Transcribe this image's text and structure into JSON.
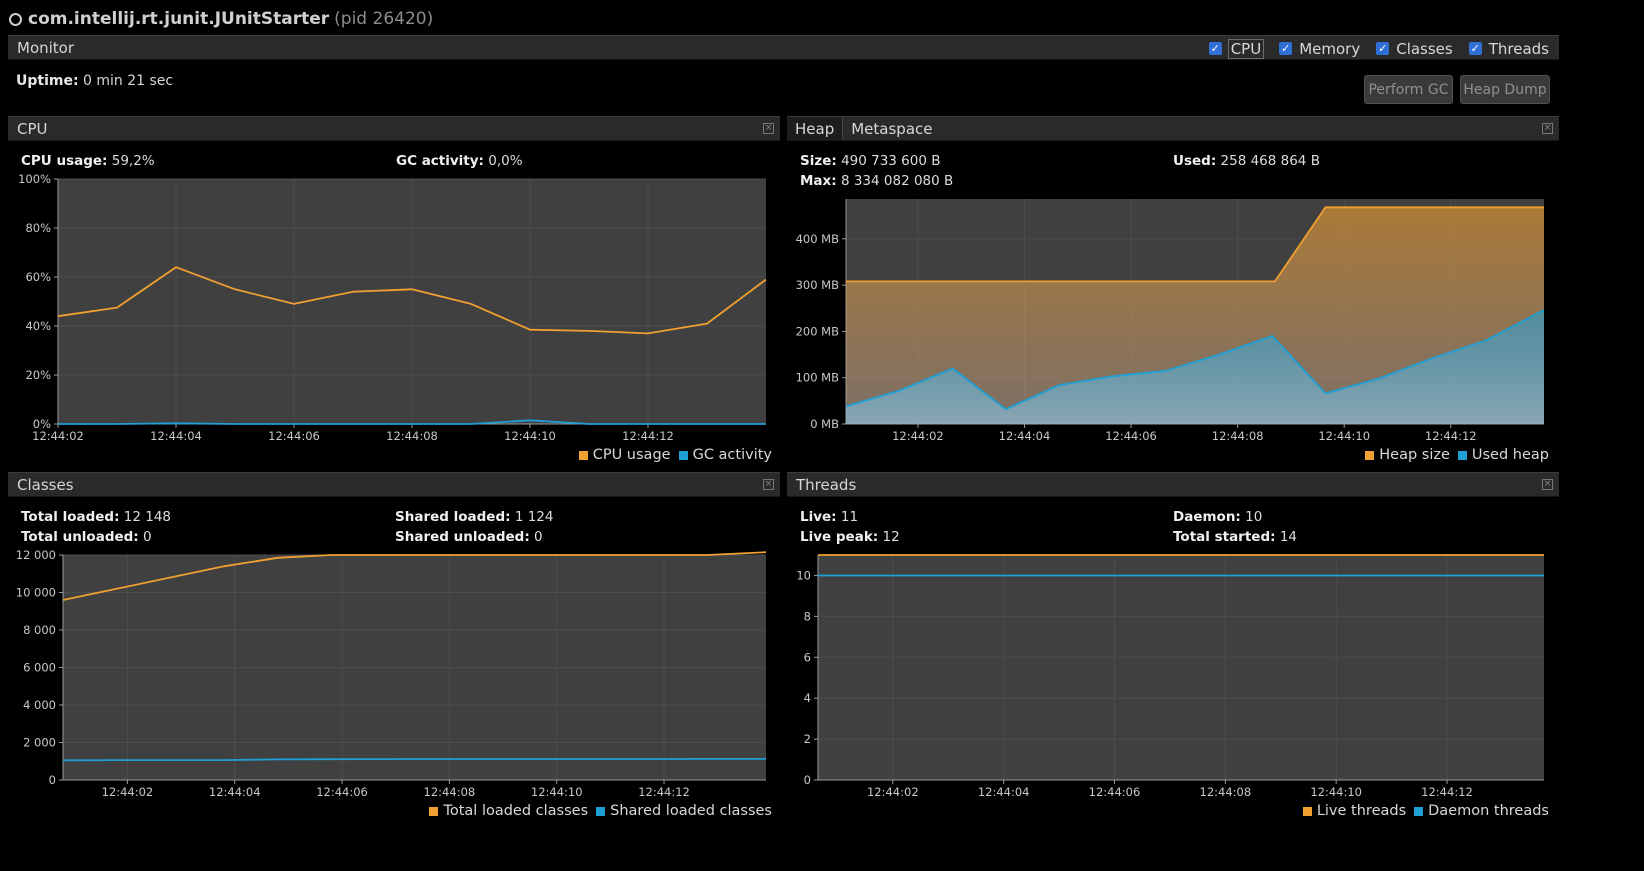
{
  "title": {
    "main": "com.intellij.rt.junit.JUnitStarter",
    "pid": "(pid 26420)"
  },
  "monitor": {
    "label": "Monitor",
    "checkboxes": [
      {
        "label": "CPU",
        "checked": true
      },
      {
        "label": "Memory",
        "checked": true
      },
      {
        "label": "Classes",
        "checked": true
      },
      {
        "label": "Threads",
        "checked": true
      }
    ],
    "uptime_label": "Uptime:",
    "uptime_value": "0 min 21 sec",
    "perform_gc": "Perform GC",
    "heap_dump": "Heap Dump"
  },
  "colors": {
    "orange": "#f0a030",
    "blue": "#1e9fd6",
    "plot_bg": "#404040"
  },
  "cpu": {
    "title": "CPU",
    "usage_label": "CPU usage:",
    "usage_value": "59,2%",
    "gc_label": "GC activity:",
    "gc_value": "0,0%",
    "legend": [
      "CPU usage",
      "GC activity"
    ]
  },
  "heap": {
    "tabs": [
      "Heap",
      "Metaspace"
    ],
    "size_label": "Size:",
    "size_value": "490 733 600 B",
    "used_label": "Used:",
    "used_value": "258 468 864 B",
    "max_label": "Max:",
    "max_value": "8 334 082 080 B",
    "legend": [
      "Heap size",
      "Used heap"
    ]
  },
  "classes": {
    "title": "Classes",
    "total_loaded_label": "Total loaded:",
    "total_loaded_value": "12 148",
    "shared_loaded_label": "Shared loaded:",
    "shared_loaded_value": "1 124",
    "total_unloaded_label": "Total unloaded:",
    "total_unloaded_value": "0",
    "shared_unloaded_label": "Shared unloaded:",
    "shared_unloaded_value": "0",
    "legend": [
      "Total loaded classes",
      "Shared loaded classes"
    ]
  },
  "threads": {
    "title": "Threads",
    "live_label": "Live:",
    "live_value": "11",
    "daemon_label": "Daemon:",
    "daemon_value": "10",
    "peak_label": "Live peak:",
    "peak_value": "12",
    "started_label": "Total started:",
    "started_value": "14",
    "legend": [
      "Live threads",
      "Daemon threads"
    ]
  },
  "chart_data": [
    {
      "type": "line",
      "ylim": [
        0,
        100
      ],
      "yticks": [
        "0%",
        "20%",
        "40%",
        "60%",
        "80%",
        "100%"
      ],
      "ytick_values": [
        0,
        20,
        40,
        60,
        80,
        100
      ],
      "xlim": [
        0,
        12
      ],
      "xticks": [
        "12:44:02",
        "12:44:04",
        "12:44:06",
        "12:44:08",
        "12:44:10",
        "12:44:12"
      ],
      "xtick_values": [
        0,
        2,
        4,
        6,
        8,
        10
      ],
      "series": [
        {
          "name": "CPU usage",
          "color": "#f0a030",
          "x": [
            0,
            1,
            2,
            3,
            4,
            5,
            6,
            7,
            8,
            9,
            10,
            11,
            12
          ],
          "values": [
            44,
            47.5,
            64,
            55,
            49,
            54,
            55,
            49,
            38.5,
            38,
            37,
            41,
            59
          ]
        },
        {
          "name": "GC activity",
          "color": "#1e9fd6",
          "x": [
            0,
            1,
            2,
            3,
            4,
            5,
            6,
            7,
            8,
            9,
            10,
            11,
            12
          ],
          "values": [
            0,
            0,
            0.3,
            0,
            0,
            0,
            0,
            0,
            1.5,
            0,
            0,
            0,
            0
          ]
        }
      ]
    },
    {
      "type": "area",
      "ylim": [
        0,
        486
      ],
      "yticks": [
        "0 MB",
        "100 MB",
        "200 MB",
        "300 MB",
        "400 MB"
      ],
      "ytick_values": [
        0,
        100,
        200,
        300,
        400
      ],
      "xlim": [
        0,
        13.1
      ],
      "xticks": [
        "12:44:02",
        "12:44:04",
        "12:44:06",
        "12:44:08",
        "12:44:10",
        "12:44:12"
      ],
      "xtick_values": [
        1.35,
        3.35,
        5.35,
        7.35,
        9.35,
        11.35
      ],
      "series": [
        {
          "name": "Heap size",
          "color": "#f0a030",
          "x": [
            0,
            8.05,
            9.0,
            13.1
          ],
          "values": [
            308,
            308,
            468,
            468
          ]
        },
        {
          "name": "Used heap",
          "color": "#1e9fd6",
          "x": [
            0,
            1,
            2,
            3,
            4,
            5,
            6,
            7,
            8,
            9,
            10,
            11,
            12,
            13.1
          ],
          "values": [
            38,
            72,
            120,
            32,
            84,
            103,
            115,
            150,
            190,
            66,
            98,
            142,
            180,
            246
          ]
        }
      ]
    },
    {
      "type": "line",
      "ylim": [
        0,
        12000
      ],
      "yticks": [
        "0",
        "2 000",
        "4 000",
        "6 000",
        "8 000",
        "10 000",
        "12 000"
      ],
      "ytick_values": [
        0,
        2000,
        4000,
        6000,
        8000,
        10000,
        12000
      ],
      "xlim": [
        0,
        13.1
      ],
      "xticks": [
        "12:44:02",
        "12:44:04",
        "12:44:06",
        "12:44:08",
        "12:44:10",
        "12:44:12"
      ],
      "xtick_values": [
        1.2,
        3.2,
        5.2,
        7.2,
        9.2,
        11.2
      ],
      "series": [
        {
          "name": "Total loaded classes",
          "color": "#f0a030",
          "x": [
            0,
            1,
            2,
            3,
            4,
            5,
            6,
            7,
            8,
            9,
            10,
            11,
            12,
            13.1
          ],
          "values": [
            9600,
            10200,
            10800,
            11400,
            11850,
            12000,
            12000,
            12000,
            12000,
            12000,
            12000,
            12000,
            12000,
            12148
          ]
        },
        {
          "name": "Shared loaded classes",
          "color": "#1e9fd6",
          "x": [
            0,
            1,
            2,
            3,
            4,
            5,
            6,
            7,
            8,
            9,
            10,
            11,
            12,
            13.1
          ],
          "values": [
            1050,
            1060,
            1060,
            1060,
            1100,
            1110,
            1115,
            1120,
            1120,
            1120,
            1120,
            1122,
            1124,
            1124
          ]
        }
      ]
    },
    {
      "type": "line",
      "ylim": [
        0,
        11
      ],
      "yticks": [
        "0",
        "2",
        "4",
        "6",
        "8",
        "10"
      ],
      "ytick_values": [
        0,
        2,
        4,
        6,
        8,
        10
      ],
      "xlim": [
        0,
        13.1
      ],
      "xticks": [
        "12:44:02",
        "12:44:04",
        "12:44:06",
        "12:44:08",
        "12:44:10",
        "12:44:12"
      ],
      "xtick_values": [
        1.35,
        3.35,
        5.35,
        7.35,
        9.35,
        11.35
      ],
      "series": [
        {
          "name": "Live threads",
          "color": "#f0a030",
          "x": [
            0,
            13.1
          ],
          "values": [
            11,
            11
          ]
        },
        {
          "name": "Daemon threads",
          "color": "#1e9fd6",
          "x": [
            0,
            13.1
          ],
          "values": [
            10,
            10
          ]
        }
      ]
    }
  ]
}
